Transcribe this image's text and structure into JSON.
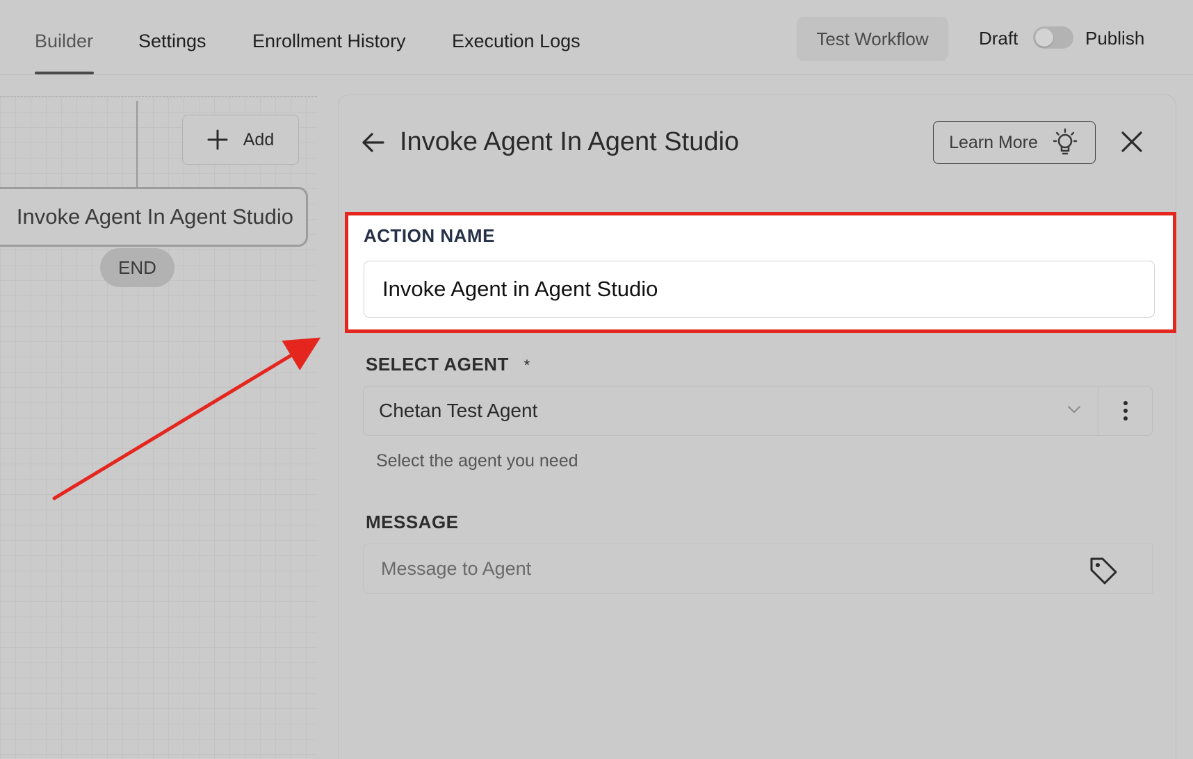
{
  "nav": {
    "tabs": [
      {
        "label": "Builder",
        "active": true
      },
      {
        "label": "Settings",
        "active": false
      },
      {
        "label": "Enrollment History",
        "active": false
      },
      {
        "label": "Execution Logs",
        "active": false
      }
    ],
    "test_workflow_label": "Test Workflow",
    "draft_label": "Draft",
    "publish_label": "Publish",
    "publish_toggle_on": false
  },
  "canvas": {
    "add_label": "Add",
    "node_label": "Invoke Agent In Agent Studio",
    "end_label": "END"
  },
  "panel": {
    "title": "Invoke Agent In Agent Studio",
    "learn_more_label": "Learn More",
    "action_name": {
      "label": "ACTION NAME",
      "value": "Invoke Agent in Agent Studio"
    },
    "select_agent": {
      "label": "SELECT AGENT",
      "required_mark": "*",
      "value": "Chetan Test Agent",
      "helper": "Select the agent you need"
    },
    "message": {
      "label": "MESSAGE",
      "placeholder": "Message to Agent"
    }
  },
  "colors": {
    "highlight_border": "#e4261e",
    "annotation_arrow": "#e4261e",
    "label_dark": "#263147"
  },
  "icons": [
    "plus-icon",
    "arrow-left-icon",
    "lightbulb-icon",
    "close-icon",
    "chevron-down-icon",
    "more-vertical-icon",
    "tag-icon"
  ]
}
